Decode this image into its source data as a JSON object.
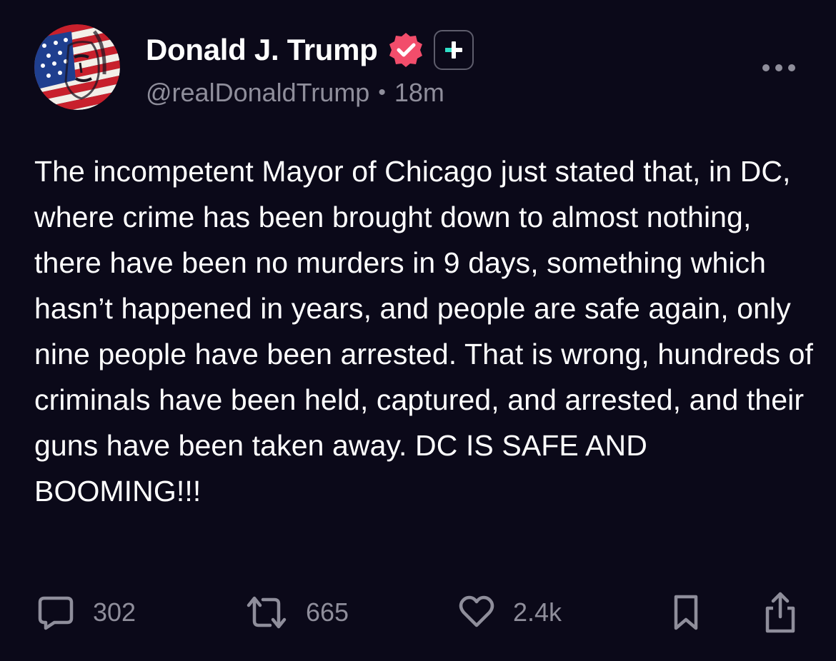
{
  "post": {
    "author": {
      "display_name": "Donald J. Trump",
      "handle": "@realDonaldTrump",
      "verified": true,
      "verified_color": "#f24d6b",
      "avatar_icon": "flag-portrait-avatar"
    },
    "separator": "•",
    "timestamp": "18m",
    "plus_badge_icon": "plus-badge-icon",
    "more_icon": "more-dots-icon",
    "text": "The incompetent Mayor of Chicago just stated that, in DC, where crime has been brought down to almost nothing, there have been no murders in 9 days, something which hasn’t happened in years, and people are safe again, only nine people have been arrested. That is wrong, hundreds of criminals have been held, captured, and arrested, and their guns have been taken away. DC IS SAFE AND BOOMING!!!",
    "actions": {
      "replies": {
        "icon": "reply-icon",
        "count": "302"
      },
      "retruths": {
        "icon": "retruth-icon",
        "count": "665"
      },
      "likes": {
        "icon": "heart-icon",
        "count": "2.4k"
      },
      "bookmark": {
        "icon": "bookmark-icon"
      },
      "share": {
        "icon": "share-icon"
      }
    }
  },
  "colors": {
    "background": "#0b0919",
    "text": "#ffffff",
    "muted": "#8f8e9b",
    "accent_teal": "#2fe0c8"
  }
}
